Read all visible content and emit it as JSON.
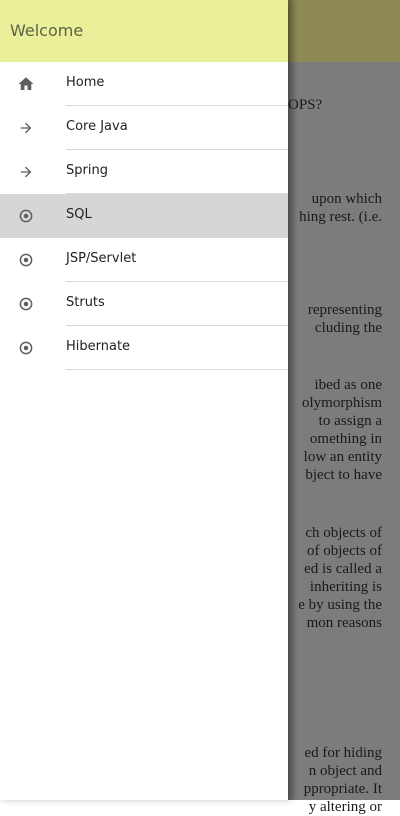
{
  "header": {
    "title": "Welcome"
  },
  "menu": {
    "items": [
      {
        "label": "Home",
        "icon": "home-icon"
      },
      {
        "label": "Core Java",
        "icon": "arrow-right-icon"
      },
      {
        "label": "Spring",
        "icon": "arrow-right-icon"
      },
      {
        "label": "SQL",
        "icon": "radio-icon",
        "active": true
      },
      {
        "label": "JSP/Servlet",
        "icon": "radio-icon"
      },
      {
        "label": "Struts",
        "icon": "radio-icon"
      },
      {
        "label": "Hibernate",
        "icon": "radio-icon"
      }
    ]
  },
  "background": {
    "lines": [
      "OPS?",
      "upon which",
      "hing rest. (i.e.",
      "representing",
      "cluding the",
      "ibed as one",
      "olymorphism",
      "to assign a",
      "omething in",
      "low an entity",
      "bject to have",
      "ch objects of",
      "of objects of",
      "ed is called a",
      "inheriting is",
      "e by using the",
      "mon reasons",
      "ed for hiding",
      "n object and",
      "ppropriate. It",
      "y altering or"
    ]
  }
}
